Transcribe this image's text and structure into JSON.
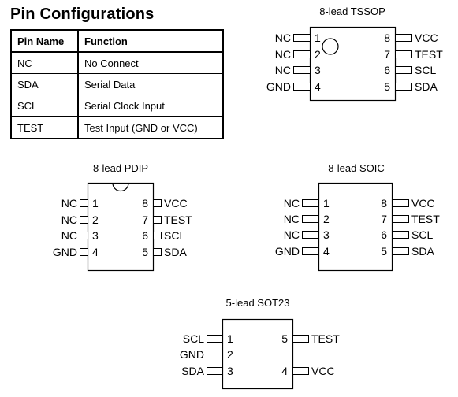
{
  "title": "Pin Configurations",
  "table": {
    "headers": [
      "Pin Name",
      "Function"
    ],
    "rows": [
      [
        "NC",
        "No Connect"
      ],
      [
        "SDA",
        "Serial Data"
      ],
      [
        "SCL",
        "Serial Clock Input"
      ],
      [
        "TEST",
        "Test Input (GND or VCC)"
      ]
    ]
  },
  "packages": [
    {
      "id": "tssop",
      "title": "8-lead TSSOP",
      "marker": "pin1-dot",
      "left": [
        {
          "num": "1",
          "name": "NC"
        },
        {
          "num": "2",
          "name": "NC"
        },
        {
          "num": "3",
          "name": "NC"
        },
        {
          "num": "4",
          "name": "GND"
        }
      ],
      "right": [
        {
          "num": "8",
          "name": "VCC"
        },
        {
          "num": "7",
          "name": "TEST"
        },
        {
          "num": "6",
          "name": "SCL"
        },
        {
          "num": "5",
          "name": "SDA"
        }
      ]
    },
    {
      "id": "pdip",
      "title": "8-lead PDIP",
      "marker": "notch",
      "left": [
        {
          "num": "1",
          "name": "NC"
        },
        {
          "num": "2",
          "name": "NC"
        },
        {
          "num": "3",
          "name": "NC"
        },
        {
          "num": "4",
          "name": "GND"
        }
      ],
      "right": [
        {
          "num": "8",
          "name": "VCC"
        },
        {
          "num": "7",
          "name": "TEST"
        },
        {
          "num": "6",
          "name": "SCL"
        },
        {
          "num": "5",
          "name": "SDA"
        }
      ]
    },
    {
      "id": "soic",
      "title": "8-lead SOIC",
      "marker": "none",
      "left": [
        {
          "num": "1",
          "name": "NC"
        },
        {
          "num": "2",
          "name": "NC"
        },
        {
          "num": "3",
          "name": "NC"
        },
        {
          "num": "4",
          "name": "GND"
        }
      ],
      "right": [
        {
          "num": "8",
          "name": "VCC"
        },
        {
          "num": "7",
          "name": "TEST"
        },
        {
          "num": "6",
          "name": "SCL"
        },
        {
          "num": "5",
          "name": "SDA"
        }
      ]
    },
    {
      "id": "sot23",
      "title": "5-lead SOT23",
      "marker": "none",
      "left": [
        {
          "num": "1",
          "name": "SCL"
        },
        {
          "num": "2",
          "name": "GND"
        },
        {
          "num": "3",
          "name": "SDA"
        }
      ],
      "right": [
        {
          "num": "5",
          "name": "TEST"
        },
        {
          "num": "",
          "name": ""
        },
        {
          "num": "4",
          "name": "VCC"
        }
      ]
    }
  ]
}
